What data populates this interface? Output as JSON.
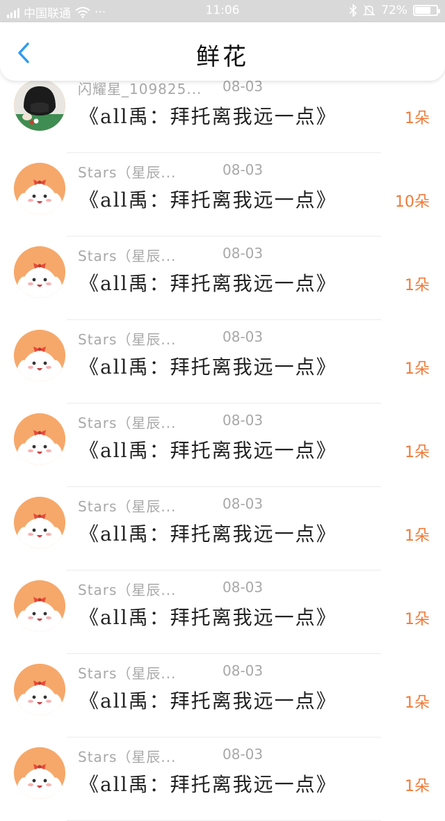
{
  "status_bar": {
    "carrier": "中国联通",
    "dots": "···",
    "time": "11:06",
    "battery_percent": "72%",
    "battery_level": 0.72,
    "icons": [
      "signal-icon",
      "wifi-icon",
      "bluetooth-icon",
      "mute-bell-icon",
      "battery-icon"
    ]
  },
  "header": {
    "title": "鲜花",
    "back_icon": "chevron-left-icon",
    "accent_color": "#2f9bef"
  },
  "colors": {
    "count_color": "#ef7a38",
    "meta_color": "#a8a8a8",
    "avatar_bg": "#f6a86a"
  },
  "rows": [
    {
      "name": "闪耀星_109825...",
      "date": "08-03",
      "book": "《all禹：拜托离我远一点》",
      "count": "1朵",
      "avatar": "photo"
    },
    {
      "name": "Stars（星辰...",
      "date": "08-03",
      "book": "《all禹：拜托离我远一点》",
      "count": "10朵",
      "avatar": "cartoon"
    },
    {
      "name": "Stars（星辰...",
      "date": "08-03",
      "book": "《all禹：拜托离我远一点》",
      "count": "1朵",
      "avatar": "cartoon"
    },
    {
      "name": "Stars（星辰...",
      "date": "08-03",
      "book": "《all禹：拜托离我远一点》",
      "count": "1朵",
      "avatar": "cartoon"
    },
    {
      "name": "Stars（星辰...",
      "date": "08-03",
      "book": "《all禹：拜托离我远一点》",
      "count": "1朵",
      "avatar": "cartoon"
    },
    {
      "name": "Stars（星辰...",
      "date": "08-03",
      "book": "《all禹：拜托离我远一点》",
      "count": "1朵",
      "avatar": "cartoon"
    },
    {
      "name": "Stars（星辰...",
      "date": "08-03",
      "book": "《all禹：拜托离我远一点》",
      "count": "1朵",
      "avatar": "cartoon"
    },
    {
      "name": "Stars（星辰...",
      "date": "08-03",
      "book": "《all禹：拜托离我远一点》",
      "count": "1朵",
      "avatar": "cartoon"
    },
    {
      "name": "Stars（星辰...",
      "date": "08-03",
      "book": "《all禹：拜托离我远一点》",
      "count": "1朵",
      "avatar": "cartoon"
    }
  ]
}
